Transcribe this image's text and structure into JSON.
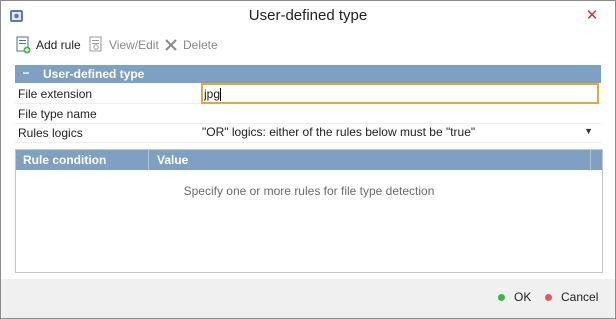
{
  "window": {
    "title": "User-defined type",
    "close": "✕"
  },
  "toolbar": {
    "add_rule": "Add rule",
    "view_edit": "View/Edit",
    "delete": "Delete"
  },
  "section": {
    "collapse": "−",
    "title": "User-defined type"
  },
  "properties": [
    {
      "label": "File extension",
      "value": "jpg"
    },
    {
      "label": "File type name",
      "value": ""
    },
    {
      "label": "Rules logics",
      "value": "\"OR\" logics: either of the rules below must be \"true\""
    }
  ],
  "grid": {
    "columns": [
      "Rule condition",
      "Value"
    ],
    "empty_message": "Specify one or more rules for file type detection"
  },
  "footer": {
    "ok": "OK",
    "cancel": "Cancel"
  },
  "colors": {
    "header": "#7ea0c2",
    "ok_dot": "#3fb34f",
    "cancel_dot": "#e05a5a",
    "focus_border": "#e0a93a"
  },
  "icons": [
    "app-icon",
    "add-rule-icon",
    "view-edit-icon",
    "delete-icon",
    "close-icon",
    "dropdown-arrow-icon"
  ]
}
